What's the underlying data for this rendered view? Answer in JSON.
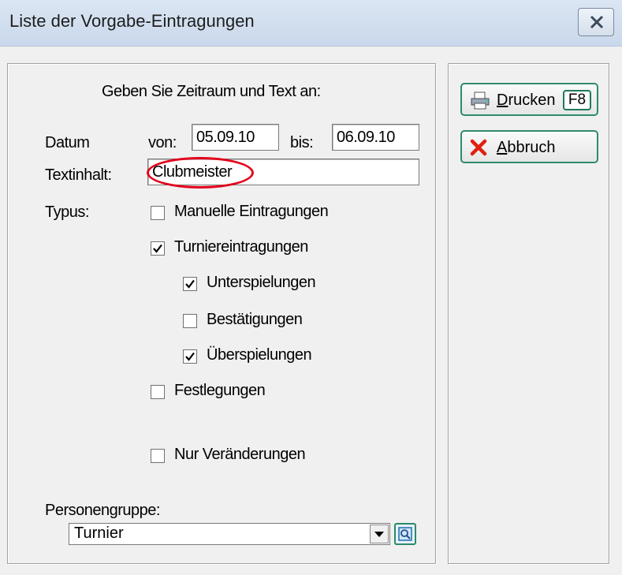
{
  "window": {
    "title": "Liste der Vorgabe-Eintragungen"
  },
  "form": {
    "instruction": "Geben Sie Zeitraum und Text an:",
    "datum_label": "Datum",
    "von_label": "von:",
    "von_value": "05.09.10",
    "bis_label": "bis:",
    "bis_value": "06.09.10",
    "textinhalt_label": "Textinhalt:",
    "textinhalt_value": "Clubmeister",
    "typus_label": "Typus:",
    "checkboxes": [
      {
        "label": "Manuelle Eintragungen",
        "checked": false
      },
      {
        "label": "Turniereintragungen",
        "checked": true
      },
      {
        "label": "Unterspielungen",
        "checked": true
      },
      {
        "label": "Bestätigungen",
        "checked": false
      },
      {
        "label": "Überspielungen",
        "checked": true
      },
      {
        "label": "Festlegungen",
        "checked": false
      },
      {
        "label": "Nur Veränderungen",
        "checked": false
      }
    ],
    "personengruppe_label": "Personengruppe:",
    "personengruppe_value": "Turnier"
  },
  "buttons": {
    "print_text": "rucken",
    "print_mnemonic": "D",
    "print_key": "F8",
    "cancel_text": "bbruch",
    "cancel_mnemonic": "A"
  },
  "colors": {
    "annotation_circle": "#e3001b",
    "button_border": "#2e8b6b",
    "titlebar": "#c9d8eb"
  },
  "icons": {
    "close": "close-icon",
    "print": "printer-icon",
    "cancel": "red-x-icon",
    "dropdown": "chevron-down-icon",
    "search": "magnifier-icon"
  }
}
